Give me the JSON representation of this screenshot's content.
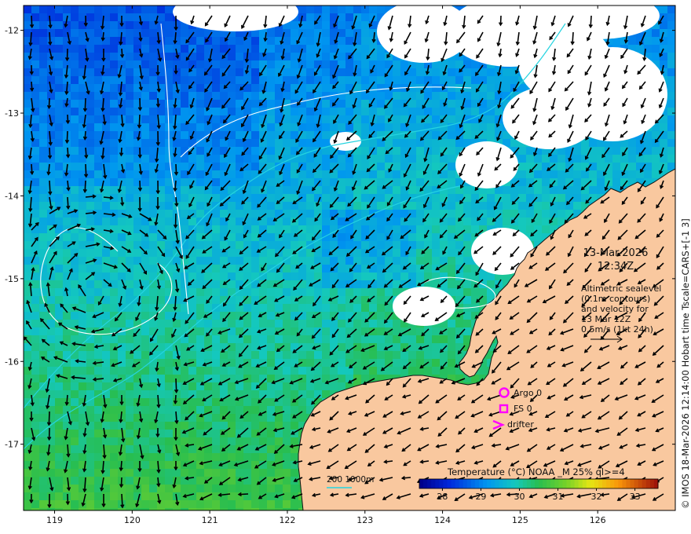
{
  "map": {
    "lon_ticks": [
      "119",
      "120",
      "121",
      "122",
      "123",
      "124",
      "125",
      "126"
    ],
    "lat_ticks": [
      "-12",
      "-13",
      "-14",
      "-15",
      "-16",
      "-17"
    ],
    "lon_range": [
      118.6,
      127.0
    ],
    "lat_range": [
      -11.7,
      -17.8
    ]
  },
  "annotation": {
    "date": "13-Mar-2026",
    "time": "12:34Z",
    "alt_lines": [
      "Altimetric sealevel",
      "(0.1m contours)",
      "and velocity for",
      "13 Mar 12Z",
      "0.5m/s (1kt 24h)"
    ]
  },
  "legend": {
    "argo": "Argo 0",
    "fs": "FS 0",
    "drifter": "drifter",
    "marker_color": "#ff00ff"
  },
  "colorbar": {
    "title": "Temperature (°C) NOAA _M 25% ql>=4",
    "ticks": [
      "28",
      "29",
      "30",
      "31",
      "32",
      "33"
    ],
    "vmin": 27.4,
    "vmax": 33.6
  },
  "depth_contours": {
    "label": "200  1000m"
  },
  "credit": {
    "text": "© IMOS 18-Mar-2026 12:14:00 Hobart time Tscale=CARS+[-1 3]"
  },
  "colors": {
    "land": "#f9c89f",
    "coast": "#111111",
    "contour": "#ffffff",
    "isobath": "#26d4e0",
    "arrow": "#000000"
  }
}
